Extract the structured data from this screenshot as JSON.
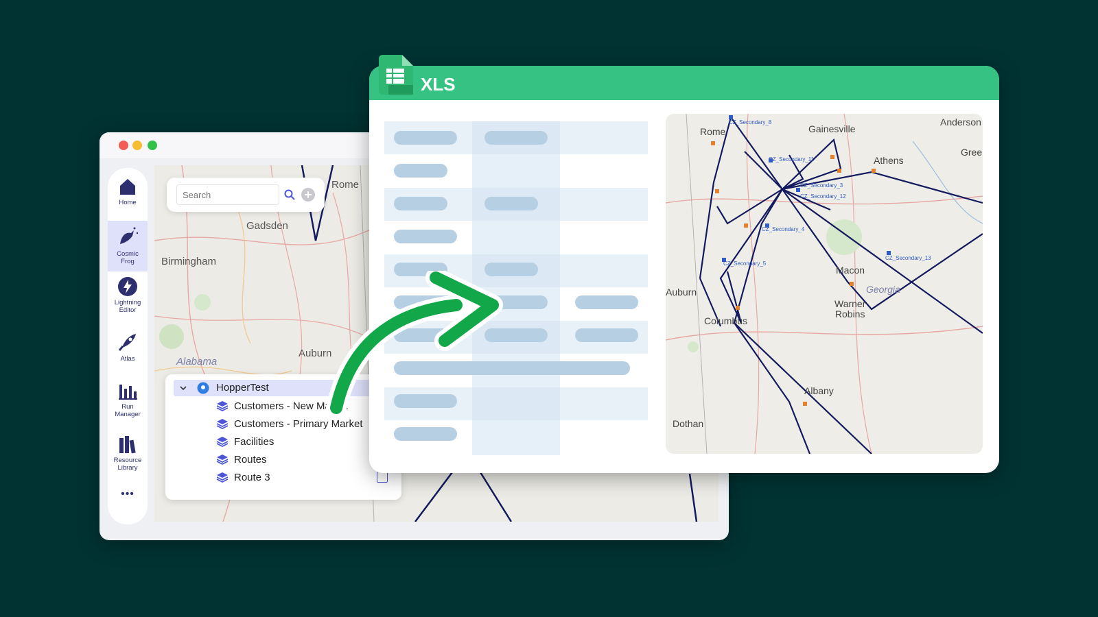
{
  "app": {
    "nav": [
      {
        "label": "Home",
        "icon": "home-icon"
      },
      {
        "label": "Cosmic\nFrog",
        "icon": "frog-icon",
        "active": true
      },
      {
        "label": "Lightning\nEditor",
        "icon": "lightning-icon"
      },
      {
        "label": "Atlas",
        "icon": "rocket-icon"
      },
      {
        "label": "Run\nManager",
        "icon": "bar-chart-icon"
      },
      {
        "label": "Resource\nLibrary",
        "icon": "books-icon"
      }
    ],
    "more_label": "•••",
    "search": {
      "placeholder": "Search"
    },
    "map_labels": {
      "gadsden": "Gadsden",
      "birmingham": "Birmingham",
      "alabama": "Alabama",
      "rome": "Rome",
      "auburn": "Auburn"
    },
    "layers": {
      "project": "HopperTest",
      "items": [
        {
          "label": "Customers - New Market",
          "checked": true
        },
        {
          "label": "Customers - Primary Market",
          "checked": true
        },
        {
          "label": "Facilities",
          "checked": true
        },
        {
          "label": "Routes",
          "checked": true
        },
        {
          "label": "Route 3",
          "checked": false
        }
      ]
    }
  },
  "xls": {
    "title": "XLS",
    "map_labels": {
      "rome": "Rome",
      "gainesville": "Gainesville",
      "anderson": "Anderson",
      "athens": "Athens",
      "gree": "Gree",
      "macon": "Macon",
      "georgia": "Georgia",
      "warner_robins": "Warner\nRobins",
      "auburn": "Auburn",
      "columbus": "Columbus",
      "albany": "Albany",
      "dothan": "Dothan"
    },
    "site_labels": [
      "CZ_Secondary_8",
      "CZ_Secondary_11",
      "CZ_Secondary_3",
      "CZ_Secondary_12",
      "CZ_Secondary_4",
      "CZ_Secondary_5",
      "CZ_Secondary_13"
    ]
  },
  "colors": {
    "background": "#023333",
    "xls_green": "#36c282",
    "arrow_green": "#12a84a",
    "route": "#131a5e",
    "accent": "#4c55d6"
  }
}
